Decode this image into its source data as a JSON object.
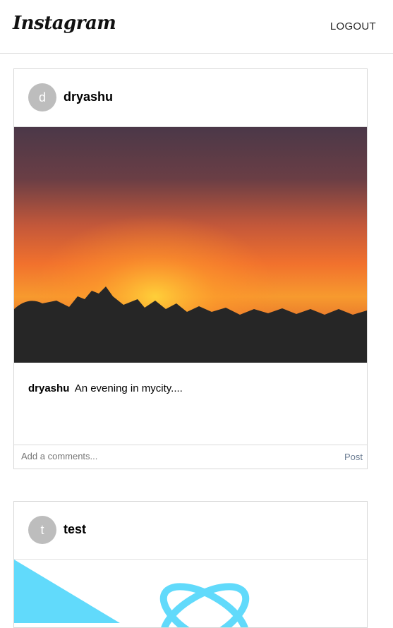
{
  "app": {
    "logo": "Instagram",
    "logout_label": "LOGOUT"
  },
  "posts": [
    {
      "avatar_letter": "d",
      "username": "dryashu",
      "caption_user": "dryashu",
      "caption_text": "An evening in mycity....",
      "comment_placeholder": "Add a comments...",
      "post_label": "Post"
    },
    {
      "avatar_letter": "t",
      "username": "test"
    }
  ],
  "colors": {
    "avatar_bg": "#bdbdbd",
    "post_button": "#6d7e94",
    "sunset_orange": "#f2722a",
    "react_blue": "#61dafb"
  }
}
